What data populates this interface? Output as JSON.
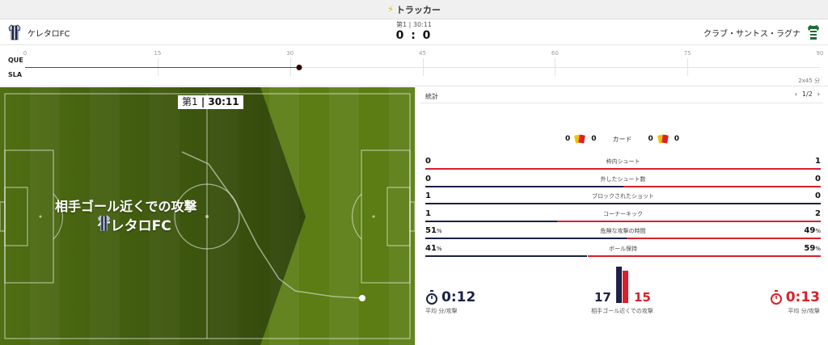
{
  "header": {
    "title": "トラッカー"
  },
  "match": {
    "home": {
      "name": "ケレタロFC",
      "jersey_colors": [
        "#1b2146",
        "#b8c4d0"
      ]
    },
    "away": {
      "name": "クラブ・サントス・ラグナ",
      "jersey_colors": [
        "#1f6b3a",
        "#ffffff"
      ]
    },
    "period": "第1 | 30:11",
    "score": "0 : 0"
  },
  "timeline": {
    "rows": [
      "QUE",
      "SLA"
    ],
    "ticks": [
      "0",
      "15",
      "30",
      "45",
      "60",
      "75",
      "90"
    ],
    "elapsed_minutes": 31,
    "total_minutes": 90,
    "duration_label": "2x45 分"
  },
  "pitch": {
    "clock_period": "第1",
    "clock_time": "30:11",
    "event_text": "相手ゴール近くでの攻撃",
    "event_team": "ケレタロFC"
  },
  "stats": {
    "heading": "統計",
    "pager": "1/2",
    "cards": {
      "label": "カード",
      "home_yellow": "0",
      "home_red": "0",
      "away_yellow": "0",
      "away_red": "0"
    },
    "rows": [
      {
        "label": "枠内シュート",
        "home": "0",
        "away": "1",
        "home_frac": 0.0,
        "away_frac": 1.0,
        "home_unit": "",
        "away_unit": ""
      },
      {
        "label": "外したシュート数",
        "home": "0",
        "away": "0",
        "home_frac": 0.5,
        "away_frac": 0.5,
        "home_unit": "",
        "away_unit": ""
      },
      {
        "label": "ブロックされたショット",
        "home": "1",
        "away": "0",
        "home_frac": 1.0,
        "away_frac": 0.0,
        "home_unit": "",
        "away_unit": ""
      },
      {
        "label": "コーナーキック",
        "home": "1",
        "away": "2",
        "home_frac": 0.333,
        "away_frac": 0.667,
        "home_unit": "",
        "away_unit": ""
      },
      {
        "label": "危険な攻撃の時間",
        "home": "51",
        "away": "49",
        "home_frac": 0.51,
        "away_frac": 0.49,
        "home_unit": "%",
        "away_unit": "%"
      },
      {
        "label": "ボール保持",
        "home": "41",
        "away": "59",
        "home_frac": 0.41,
        "away_frac": 0.59,
        "home_unit": "%",
        "away_unit": "%"
      }
    ],
    "home_speed": "0:12",
    "away_speed": "0:13",
    "speed_label": "平均 分/攻撃",
    "danger_home": "17",
    "danger_away": "15",
    "danger_label": "相手ゴール近くでの攻撃"
  },
  "colors": {
    "home": "#1b2146",
    "away": "#d9202a",
    "pitch": "#5b7d14"
  }
}
